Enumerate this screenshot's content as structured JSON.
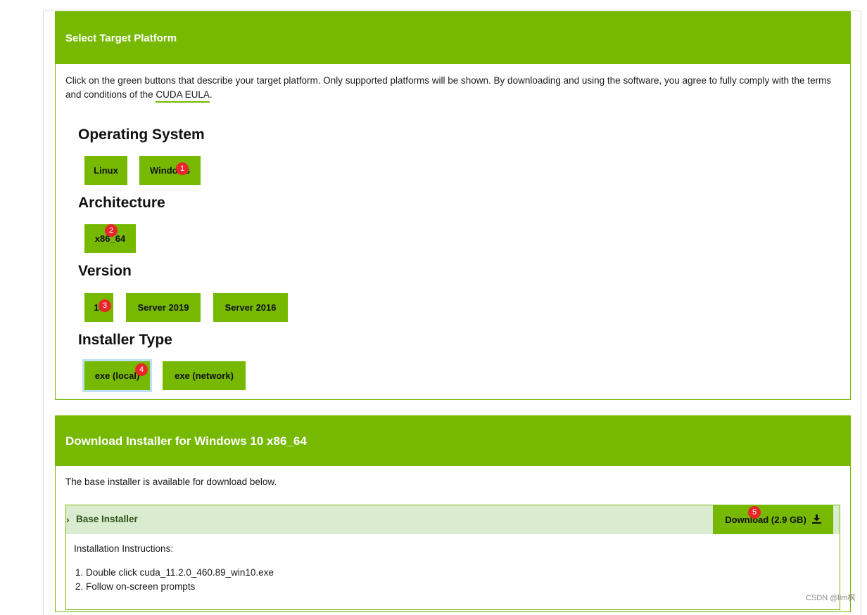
{
  "select_panel": {
    "title": "Select Target Platform",
    "intro_text": "Click on the green buttons that describe your target platform. Only supported platforms will be shown. By downloading and using the software, you agree to fully comply with the terms and conditions of the",
    "eula_link": "CUDA EULA",
    "intro_end": ".",
    "sections": {
      "os": {
        "title": "Operating System",
        "options": [
          "Linux",
          "Windows"
        ]
      },
      "arch": {
        "title": "Architecture",
        "options": [
          "x86_64"
        ]
      },
      "version": {
        "title": "Version",
        "options": [
          "10",
          "Server 2019",
          "Server 2016"
        ]
      },
      "installer": {
        "title": "Installer Type",
        "options": [
          "exe (local)",
          "exe (network)"
        ]
      }
    }
  },
  "badges": [
    "1",
    "2",
    "3",
    "4",
    "5"
  ],
  "download_panel": {
    "title": "Download Installer for Windows 10 x86_64",
    "text": "The base installer is available for download below.",
    "base_installer": {
      "label": "Base Installer",
      "download_label": "Download (2.9 GB)",
      "instructions_title": "Installation Instructions:",
      "steps": [
        "1. Double click cuda_11.2.0_460.89_win10.exe",
        "2. Follow on-screen prompts"
      ]
    }
  },
  "watermark": "CSDN @lim枫",
  "colors": {
    "accent": "#76b900",
    "badge": "#e8262b",
    "installer_header": "#d9ecd0"
  }
}
